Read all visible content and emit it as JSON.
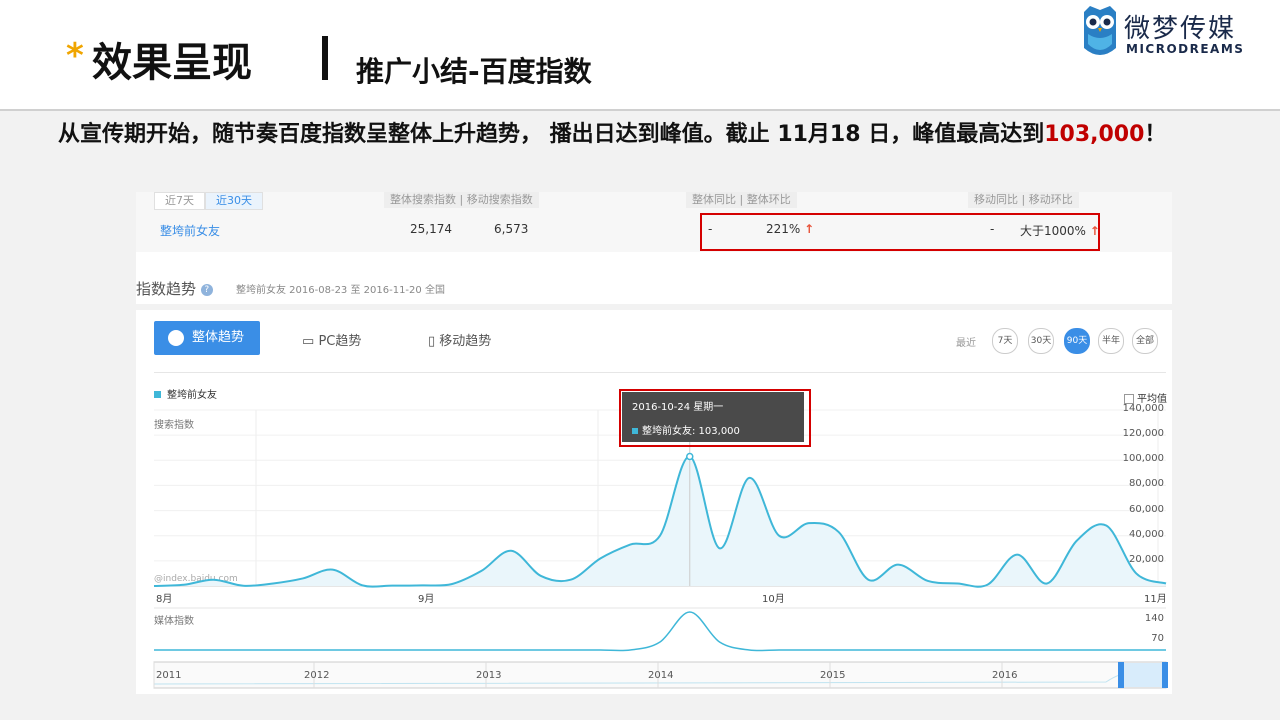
{
  "header": {
    "star": "*",
    "title": "效果呈现",
    "subtitle": "推广小结-百度指数",
    "logo_cn": "微梦传媒",
    "logo_en": "MICRODREAMS"
  },
  "summary": {
    "text_before": "从宣传期开始，随节奏百度指数呈整体上升趋势， 播出日达到峰值。截止 11月18 日，峰值最高达到",
    "highlight": "103,000",
    "text_after": "！"
  },
  "stats": {
    "tabs": [
      "近7天",
      "近30天"
    ],
    "col_headers": [
      "整体搜索指数 | 移动搜索指数",
      "整体同比 | 整体环比",
      "移动同比 | 移动环比"
    ],
    "keyword": "整垮前女友",
    "overall_search": "25,174",
    "mobile_search": "6,573",
    "overall_yoy": "-",
    "overall_mom": "221%",
    "mobile_yoy": "-",
    "mobile_mom": "大于1000%"
  },
  "trend": {
    "section_title": "指数趋势",
    "meta": "整垮前女友    2016-08-23 至 2016-11-20    全国",
    "btn_overall": "整体趋势",
    "btn_pc": "PC趋势",
    "btn_mobile": "移动趋势",
    "range_label": "最近",
    "ranges": [
      "7天",
      "30天",
      "90天",
      "半年",
      "全部"
    ],
    "legend": "整垮前女友",
    "avg_label": "平均值",
    "search_label": "搜索指数",
    "media_label": "媒体指数",
    "watermark": "@index.baidu.com",
    "tooltip_date": "2016-10-24 星期一",
    "tooltip_value": "整垮前女友: 103,000",
    "media_ticks": [
      "140",
      "70"
    ]
  },
  "colors": {
    "accent": "#3a8ee6",
    "line": "#3fb7d8",
    "highlight_box": "#d40000",
    "summary_red": "#c00000"
  },
  "chart_data": {
    "type": "line",
    "x": [
      "08-23",
      "08-28",
      "09-03",
      "09-08",
      "09-13",
      "09-17",
      "09-22",
      "09-27",
      "10-02",
      "10-05",
      "10-08",
      "10-10",
      "10-12",
      "10-14",
      "10-17",
      "10-19",
      "10-21",
      "10-23",
      "10-24",
      "10-25",
      "10-26",
      "10-27",
      "10-29",
      "11-01",
      "11-03",
      "11-05",
      "11-07",
      "11-09",
      "11-11",
      "11-13",
      "11-15",
      "11-17",
      "11-18",
      "11-19",
      "11-20"
    ],
    "series": [
      {
        "name": "整垮前女友",
        "values": [
          0,
          1000,
          5000,
          200,
          2000,
          6000,
          13000,
          500,
          300,
          500,
          1500,
          12000,
          28000,
          8000,
          5000,
          22000,
          33000,
          40000,
          103000,
          30000,
          86000,
          40000,
          50000,
          43000,
          5000,
          17000,
          4000,
          2000,
          1000,
          25000,
          2000,
          36000,
          48000,
          10000,
          2000
        ]
      }
    ],
    "y_ticks": [
      "20,000",
      "40,000",
      "60,000",
      "80,000",
      "100,000",
      "120,000",
      "140,000"
    ],
    "ylim": [
      0,
      140000
    ],
    "x_ticks": [
      "8月",
      "9月",
      "10月",
      "11月"
    ],
    "overview_ticks": [
      "2011",
      "2012",
      "2013",
      "2014",
      "2015",
      "2016"
    ],
    "grid": true
  }
}
